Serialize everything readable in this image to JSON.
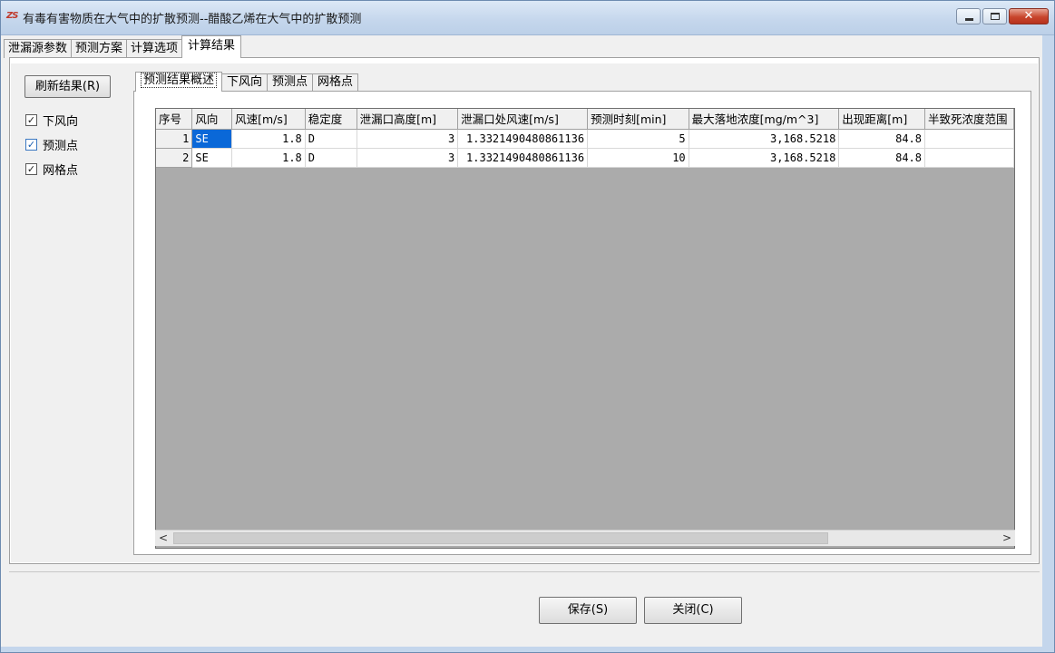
{
  "window": {
    "title": "有毒有害物质在大气中的扩散预测--醋酸乙烯在大气中的扩散预测",
    "controls": [
      "minimize",
      "maximize",
      "close"
    ]
  },
  "top_tabs": [
    {
      "label": "泄漏源参数"
    },
    {
      "label": "预测方案"
    },
    {
      "label": "计算选项"
    },
    {
      "label": "计算结果"
    }
  ],
  "left_panel": {
    "refresh_button": "刷新结果(R)",
    "checks": [
      {
        "label": "下风向",
        "checked": true
      },
      {
        "label": "预测点",
        "checked": true
      },
      {
        "label": "网格点",
        "checked": true
      }
    ]
  },
  "inner_tabs": [
    {
      "label": "预测结果概述"
    },
    {
      "label": "下风向"
    },
    {
      "label": "预测点"
    },
    {
      "label": "网格点"
    }
  ],
  "grid": {
    "columns": [
      "序号",
      "风向",
      "风速[m/s]",
      "稳定度",
      "泄漏口高度[m]",
      "泄漏口处风速[m/s]",
      "预测时刻[min]",
      "最大落地浓度[mg/m^3]",
      "出现距离[m]",
      "半致死浓度范围"
    ],
    "rows": [
      [
        "1",
        "SE",
        "1.8",
        "D",
        "3",
        "1.3321490480861136",
        "5",
        "3,168.5218",
        "84.8",
        ""
      ],
      [
        "2",
        "SE",
        "1.8",
        "D",
        "3",
        "1.3321490480861136",
        "10",
        "3,168.5218",
        "84.8",
        ""
      ]
    ],
    "selected_cell": "SE"
  },
  "footer": {
    "save_button": "保存(S)",
    "close_button": "关闭(C)"
  },
  "colors": {
    "selection": "#0a68d8",
    "grid_background": "#ababab",
    "close_button": "#c8452c"
  },
  "icons": {
    "app": "app-logo-icon",
    "checkbox": "checkmark-icon",
    "scroll_left": "arrow-left-icon",
    "scroll_right": "arrow-right-icon"
  }
}
